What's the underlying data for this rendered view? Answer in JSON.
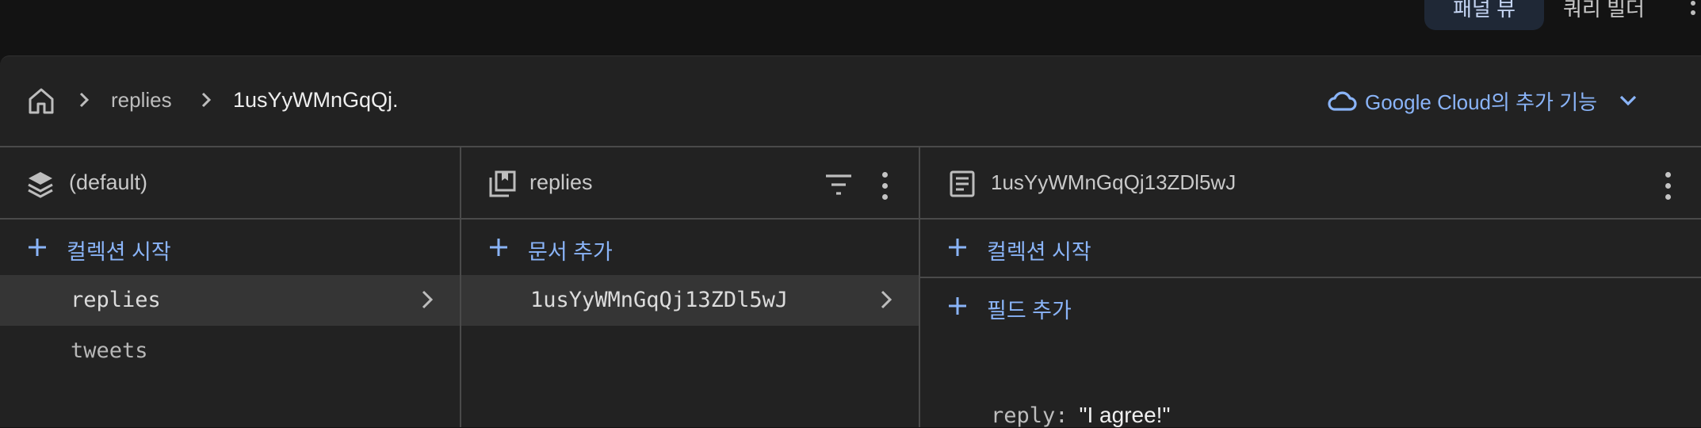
{
  "topbar": {
    "view_tab": "패널 뷰",
    "query_tab": "쿼리 빌더"
  },
  "breadcrumb": {
    "items": [
      "replies",
      "1usYyWMnGqQj."
    ]
  },
  "cloud_menu": {
    "label": "Google Cloud의 추가 기능"
  },
  "databases": {
    "title": "(default)",
    "add_label": "컬렉션 시작",
    "items": [
      "replies",
      "tweets"
    ]
  },
  "collection": {
    "title": "replies",
    "add_label": "문서 추가",
    "items": [
      "1usYyWMnGqQj13ZDl5wJ"
    ]
  },
  "document": {
    "title": "1usYyWMnGqQj13ZDl5wJ",
    "add_collection_label": "컬렉션 시작",
    "add_field_label": "필드 추가",
    "fields": [
      {
        "key": "reply:",
        "value": "\"I agree!\""
      }
    ]
  },
  "colors": {
    "accent": "#8ab4f8",
    "panel": "#222222",
    "selected": "#353535"
  }
}
